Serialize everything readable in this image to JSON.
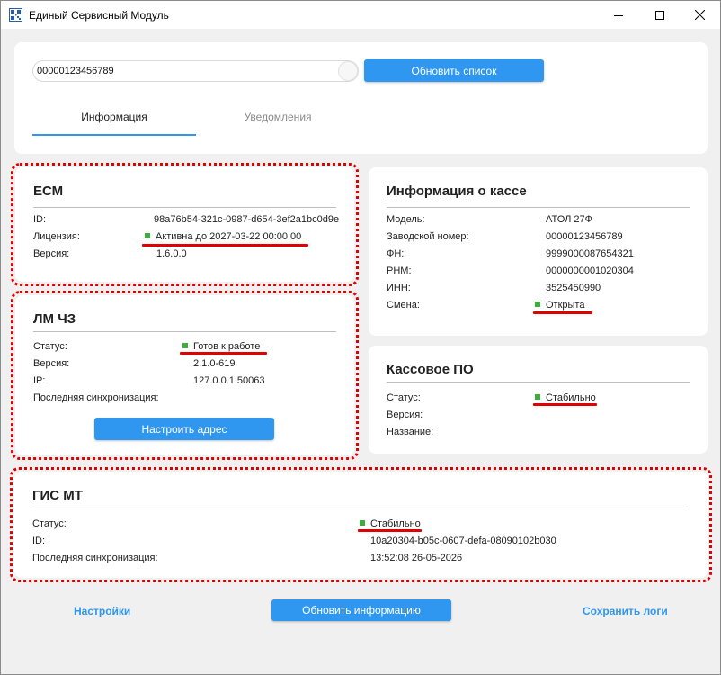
{
  "window": {
    "title": "Единый Сервисный Модуль",
    "accent": "#2f97f0",
    "status_ok": "#3dae3d",
    "highlight": "#e00000"
  },
  "top": {
    "search_value": "00000123456789",
    "refresh_list_label": "Обновить список",
    "tabs": [
      {
        "label": "Информация",
        "active": true
      },
      {
        "label": "Уведомления",
        "active": false
      }
    ]
  },
  "ecm": {
    "title": "ЕСМ",
    "rows": [
      {
        "label": "ID:",
        "value": "98a76b54-321c-0987-d654-3ef2a1bc0d9e"
      },
      {
        "label": "Лицензия:",
        "value": "Активна до 2027-03-22 00:00:00"
      },
      {
        "label": "Версия:",
        "value": "1.6.0.0"
      }
    ]
  },
  "lm": {
    "title": "ЛМ ЧЗ",
    "rows": [
      {
        "label": "Статус:",
        "value": "Готов к работе"
      },
      {
        "label": "Версия:",
        "value": "2.1.0-619"
      },
      {
        "label": "IP:",
        "value": "127.0.0.1:50063"
      },
      {
        "label": "Последняя синхронизация:",
        "value": ""
      }
    ],
    "button_label": "Настроить адрес"
  },
  "kassa": {
    "title": "Информация о кассе",
    "rows": [
      {
        "label": "Модель:",
        "value": "АТОЛ 27Ф"
      },
      {
        "label": "Заводской номер:",
        "value": "00000123456789"
      },
      {
        "label": "ФН:",
        "value": "9999000087654321"
      },
      {
        "label": "РНМ:",
        "value": "0000000001020304"
      },
      {
        "label": "ИНН:",
        "value": "3525450990"
      },
      {
        "label": "Смена:",
        "value": "Открыта"
      }
    ]
  },
  "po": {
    "title": "Кассовое ПО",
    "rows": [
      {
        "label": "Статус:",
        "value": "Стабильно"
      },
      {
        "label": "Версия:",
        "value": ""
      },
      {
        "label": "Название:",
        "value": ""
      }
    ]
  },
  "gis": {
    "title": "ГИС МТ",
    "rows": [
      {
        "label": "Статус:",
        "value": "Стабильно"
      },
      {
        "label": "ID:",
        "value": "10a20304-b05c-0607-defa-08090102b030"
      },
      {
        "label": "Последняя синхронизация:",
        "value": "13:52:08 26-05-2026"
      }
    ]
  },
  "footer": {
    "settings_label": "Настройки",
    "update_info_label": "Обновить информацию",
    "save_logs_label": "Сохранить логи"
  }
}
